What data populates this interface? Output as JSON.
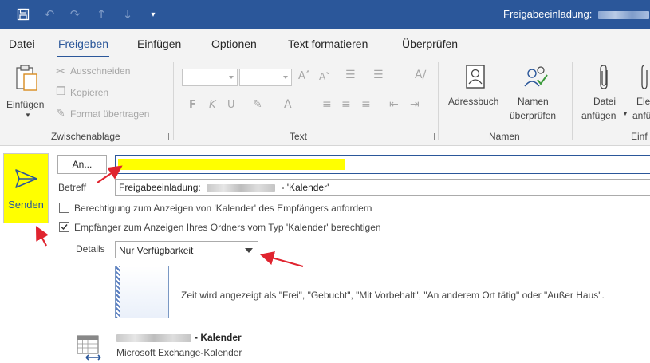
{
  "titlebar": {
    "title": "Freigabeeinladung:",
    "quick_access": [
      "save-icon",
      "undo-icon",
      "redo-icon",
      "up-arrow-icon",
      "down-arrow-icon",
      "customize-icon"
    ]
  },
  "menu": {
    "tabs": [
      "Datei",
      "Freigeben",
      "Einfügen",
      "Optionen",
      "Text formatieren",
      "Überprüfen"
    ],
    "active_tab": "Freigeben"
  },
  "ribbon": {
    "clipboard": {
      "paste": "Einfügen",
      "cut": "Ausschneiden",
      "copy": "Kopieren",
      "format_painter": "Format übertragen",
      "group_label": "Zwischenablage"
    },
    "text": {
      "bold": "F",
      "italic": "K",
      "underline": "U",
      "group_label": "Text"
    },
    "names": {
      "address_book": "Adressbuch",
      "check_names_line1": "Namen",
      "check_names_line2": "überprüfen",
      "group_label": "Namen"
    },
    "include": {
      "attach_line1": "Datei",
      "attach_line2": "anfügen",
      "item_line1": "Ele",
      "item_line2": "anfü",
      "group_label": "Einf"
    }
  },
  "compose": {
    "send_label": "Senden",
    "to_button": "An...",
    "subject_label": "Betreff",
    "subject_prefix": "Freigabeeinladung:",
    "subject_suffix": "- 'Kalender'",
    "request_permission": {
      "label": "Berechtigung zum Anzeigen von 'Kalender' des Empfängers anfordern",
      "checked": false
    },
    "grant_permission": {
      "label": "Empfänger zum Anzeigen Ihres Ordners vom Typ 'Kalender' berechtigen",
      "checked": true
    },
    "details_label": "Details",
    "details_value": "Nur Verfügbarkeit",
    "preview_text": "Zeit wird angezeigt als \"Frei\", \"Gebucht\", \"Mit Vorbehalt\", \"An anderem Ort tätig\" oder \"Außer Haus\".",
    "calendar_suffix": "- Kalender",
    "calendar_type": "Microsoft Exchange-Kalender"
  },
  "colors": {
    "titlebar": "#2b579a",
    "highlight": "#ffff00",
    "annotation": "#e0242f"
  }
}
